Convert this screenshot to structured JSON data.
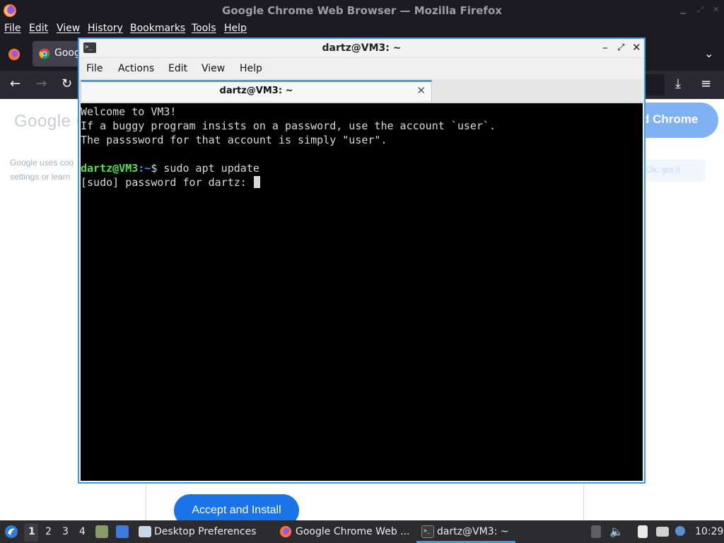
{
  "firefox": {
    "window_title": "Google Chrome Web Browser — Mozilla Firefox",
    "menu": [
      "File",
      "Edit",
      "View",
      "History",
      "Bookmarks",
      "Tools",
      "Help"
    ],
    "tab_label": "Goog",
    "page": {
      "logo_text": "Google C",
      "cookie_line1": "Google uses coo",
      "cookie_line2": "settings or learn",
      "get_chrome_label": "d Chrome",
      "ok_label": "Ok, got it",
      "accept_button": "Accept and Install"
    }
  },
  "terminal": {
    "title": "dartz@VM3: ~",
    "menu": [
      "File",
      "Actions",
      "Edit",
      "View",
      "Help"
    ],
    "tab_label": "dartz@VM3: ~",
    "lines": [
      "Welcome to VM3!",
      "If a buggy program insists on a password, use the account `user`.",
      "The passsword for that account is simply \"user\"."
    ],
    "prompt_user": "dartz@VM3",
    "prompt_path": ":~",
    "command": "$ sudo apt update",
    "sudo_prompt": "[sudo] password for dartz: "
  },
  "taskbar": {
    "workspaces": [
      "1",
      "2",
      "3",
      "4"
    ],
    "active_workspace": "1",
    "tasks": [
      {
        "label": "Desktop Preferences"
      },
      {
        "label": "Google Chrome Web ..."
      },
      {
        "label": "dartz@VM3: ~"
      }
    ],
    "clock": "10:29"
  },
  "colors": {
    "accent": "#3a9fdd",
    "prompt_user": "#4ee24e",
    "prompt_path": "#3f8fff",
    "google_blue": "#1a73e8"
  }
}
